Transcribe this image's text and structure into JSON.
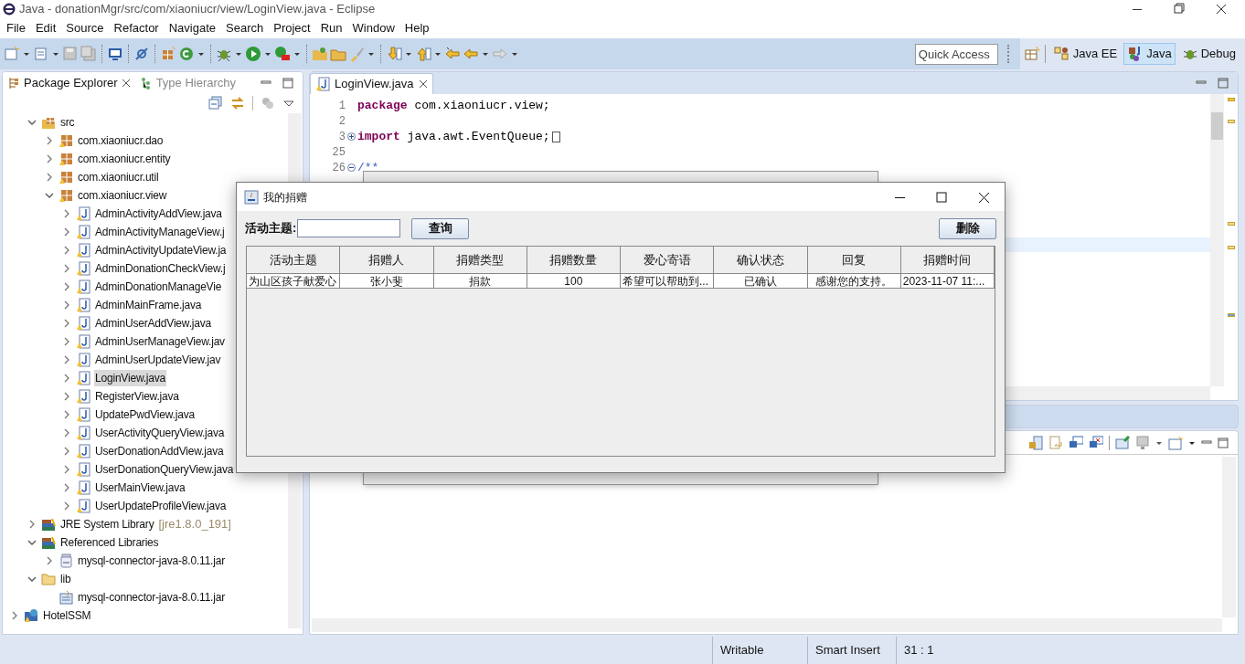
{
  "window": {
    "title": "Java - donationMgr/src/com/xiaoniucr/view/LoginView.java - Eclipse"
  },
  "menu": [
    "File",
    "Edit",
    "Source",
    "Refactor",
    "Navigate",
    "Search",
    "Project",
    "Run",
    "Window",
    "Help"
  ],
  "quick_access": {
    "placeholder": "Quick Access"
  },
  "perspectives": [
    {
      "label": "Java EE",
      "kind": "javaee",
      "selected": false
    },
    {
      "label": "Java",
      "kind": "java",
      "selected": true
    },
    {
      "label": "Debug",
      "kind": "debug",
      "selected": false
    }
  ],
  "explorer": {
    "tabs": [
      {
        "label": "Package Explorer",
        "selected": true
      },
      {
        "label": "Type Hierarchy",
        "selected": false
      }
    ],
    "tree": [
      {
        "children": [
          {
            "label": "src",
            "kind": "source_folder",
            "expanded": true,
            "selected": false,
            "children": [
              {
                "label": "com.xiaoniucr.dao",
                "kind": "package",
                "expanded": false,
                "selected": false
              },
              {
                "label": "com.xiaoniucr.entity",
                "kind": "package",
                "expanded": false,
                "selected": false
              },
              {
                "label": "com.xiaoniucr.util",
                "kind": "package",
                "expanded": false,
                "selected": false
              },
              {
                "label": "com.xiaoniucr.view",
                "kind": "package",
                "expanded": true,
                "selected": false,
                "children": [
                  {
                    "label": "AdminActivityAddView.java",
                    "kind": "java_file",
                    "expanded": false,
                    "selected": false
                  },
                  {
                    "label": "AdminActivityManageView.j",
                    "kind": "java_file",
                    "expanded": false,
                    "selected": false
                  },
                  {
                    "label": "AdminActivityUpdateView.ja",
                    "kind": "java_file",
                    "expanded": false,
                    "selected": false
                  },
                  {
                    "label": "AdminDonationCheckView.j",
                    "kind": "java_file",
                    "expanded": false,
                    "selected": false
                  },
                  {
                    "label": "AdminDonationManageVie",
                    "kind": "java_file",
                    "expanded": false,
                    "selected": false
                  },
                  {
                    "label": "AdminMainFrame.java",
                    "kind": "java_file",
                    "expanded": false,
                    "selected": false
                  },
                  {
                    "label": "AdminUserAddView.java",
                    "kind": "java_file",
                    "expanded": false,
                    "selected": false
                  },
                  {
                    "label": "AdminUserManageView.jav",
                    "kind": "java_file",
                    "expanded": false,
                    "selected": false
                  },
                  {
                    "label": "AdminUserUpdateView.jav",
                    "kind": "java_file",
                    "expanded": false,
                    "selected": false
                  },
                  {
                    "label": "LoginView.java",
                    "kind": "java_file",
                    "expanded": false,
                    "selected": true
                  },
                  {
                    "label": "RegisterView.java",
                    "kind": "java_file",
                    "expanded": false,
                    "selected": false
                  },
                  {
                    "label": "UpdatePwdView.java",
                    "kind": "java_file",
                    "expanded": false,
                    "selected": false
                  },
                  {
                    "label": "UserActivityQueryView.java",
                    "kind": "java_file",
                    "expanded": false,
                    "selected": false
                  },
                  {
                    "label": "UserDonationAddView.java",
                    "kind": "java_file",
                    "expanded": false,
                    "selected": false
                  },
                  {
                    "label": "UserDonationQueryView.java",
                    "kind": "java_file",
                    "expanded": false,
                    "selected": false
                  },
                  {
                    "label": "UserMainView.java",
                    "kind": "java_file",
                    "expanded": false,
                    "selected": false
                  },
                  {
                    "label": "UserUpdateProfileView.java",
                    "kind": "java_file",
                    "expanded": false,
                    "selected": false
                  }
                ]
              }
            ]
          },
          {
            "label": "JRE System Library",
            "detail": "[jre1.8.0_191]",
            "kind": "library",
            "expanded": false,
            "selected": false
          },
          {
            "label": "Referenced Libraries",
            "kind": "library",
            "expanded": true,
            "selected": false,
            "children": [
              {
                "label": "mysql-connector-java-8.0.11.jar",
                "kind": "jar",
                "expanded": false,
                "selected": false
              }
            ]
          },
          {
            "label": "lib",
            "kind": "folder",
            "expanded": true,
            "selected": false,
            "children": [
              {
                "label": "mysql-connector-java-8.0.11.jar",
                "kind": "jar_file",
                "selected": false
              }
            ]
          }
        ]
      },
      {
        "label": "HotelSSM",
        "kind": "project",
        "expanded": false,
        "selected": false
      }
    ]
  },
  "editor": {
    "tab": "LoginView.java",
    "lines": [
      {
        "number": "1",
        "code": "**package** com.xiaoniucr.view;",
        "kind": "code"
      },
      {
        "number": "2"
      },
      {
        "number": "3",
        "code": "**import** java.awt.EventQueue;",
        "kind": "code",
        "folded": true
      },
      {
        "number": "25"
      },
      {
        "number": "26",
        "code": "/**",
        "kind": "comment",
        "folded": false
      }
    ]
  },
  "dialog": {
    "title": "我的捐赠",
    "search_label": "活动主题:",
    "buttons": [
      "查询",
      "删除"
    ],
    "columns": [
      "活动主题",
      "捐赠人",
      "捐赠类型",
      "捐赠数量",
      "爱心寄语",
      "确认状态",
      "回复",
      "捐赠时间"
    ],
    "rows": [
      [
        "为山区孩子献爱心",
        "张小斐",
        "捐款",
        "100",
        "希望可以帮助到...",
        "已确认",
        "感谢您的支持。",
        "2023-11-07 11:..."
      ]
    ]
  },
  "status_bar": [
    "Writable",
    "Smart Insert",
    "31 : 1"
  ]
}
